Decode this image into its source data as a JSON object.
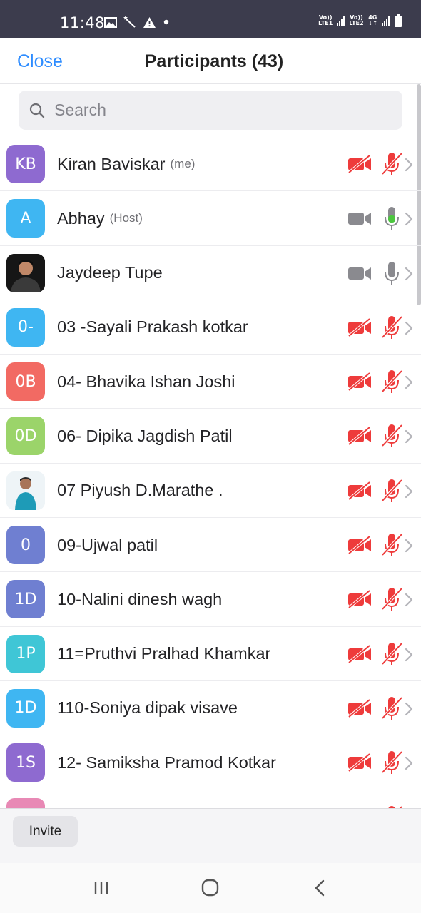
{
  "status_bar": {
    "time": "11:48",
    "sim1_top": "Vo))",
    "sim1_bottom": "LTE1",
    "sim2_top": "Vo))",
    "sim2_bottom": "LTE2",
    "network": "4G"
  },
  "header": {
    "close_label": "Close",
    "title": "Participants (43)"
  },
  "search": {
    "placeholder": "Search"
  },
  "participants": [
    {
      "initials": "KB",
      "name": "Kiran Baviskar",
      "role": "(me)",
      "avatar_color": "#8e6ad0",
      "video": "off",
      "mic": "muted"
    },
    {
      "initials": "A",
      "name": "Abhay",
      "role": "(Host)",
      "avatar_color": "#3fb6f2",
      "video": "on",
      "mic": "active"
    },
    {
      "initials": "",
      "name": "Jaydeep Tupe",
      "role": "",
      "avatar_color": "#222222",
      "avatar_photo": true,
      "video": "on",
      "mic": "on"
    },
    {
      "initials": "0-",
      "name": "03 -Sayali  Prakash kotkar",
      "role": "",
      "avatar_color": "#3fb6f2",
      "video": "off",
      "mic": "muted"
    },
    {
      "initials": "0B",
      "name": "04- Bhavika Ishan Joshi",
      "role": "",
      "avatar_color": "#f26a63",
      "video": "off",
      "mic": "muted"
    },
    {
      "initials": "0D",
      "name": "06- Dipika Jagdish Patil",
      "role": "",
      "avatar_color": "#9bd46a",
      "video": "off",
      "mic": "muted"
    },
    {
      "initials": "",
      "name": "07 Piyush D.Marathe .",
      "role": "",
      "avatar_color": "#e9f1f4",
      "avatar_photo": true,
      "video": "off",
      "mic": "muted"
    },
    {
      "initials": "0",
      "name": "09-Ujwal  patil",
      "role": "",
      "avatar_color": "#6f7fd1",
      "video": "off",
      "mic": "muted"
    },
    {
      "initials": "1D",
      "name": "10-Nalini dinesh wagh",
      "role": "",
      "avatar_color": "#6f7fd1",
      "video": "off",
      "mic": "muted"
    },
    {
      "initials": "1P",
      "name": "11=Pruthvi Pralhad Khamkar",
      "role": "",
      "avatar_color": "#3fc6d6",
      "video": "off",
      "mic": "muted"
    },
    {
      "initials": "1D",
      "name": "110-Soniya dipak visave",
      "role": "",
      "avatar_color": "#3fb6f2",
      "video": "off",
      "mic": "muted"
    },
    {
      "initials": "1S",
      "name": "12- Samiksha Pramod Kotkar",
      "role": "",
      "avatar_color": "#8e6ad0",
      "video": "off",
      "mic": "muted"
    },
    {
      "initials": "",
      "name": "",
      "role": "",
      "avatar_color": "#e889b5",
      "video": "off",
      "mic": "muted"
    }
  ],
  "footer": {
    "invite_label": "Invite"
  },
  "colors": {
    "accent": "#2d8cff",
    "muted_red": "#ee3b3b",
    "active_green": "#4cc63f",
    "icon_gray": "#8a8a8f"
  }
}
